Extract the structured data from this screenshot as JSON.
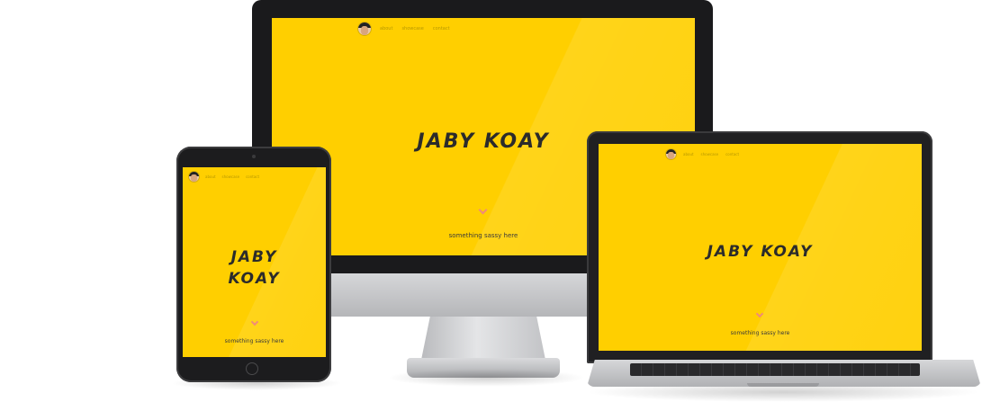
{
  "site": {
    "name": "JABY KOAY",
    "tagline": "something sassy here",
    "nav": [
      "about",
      "showcase",
      "contact"
    ]
  },
  "icons": {
    "avatar": "avatar-photo",
    "scroll": "chevron-down-icon"
  },
  "colors": {
    "screen": "#ffcf00",
    "title": "#2b2b2b",
    "chevron": "#f08a7a",
    "bezel": "#1a1a1c",
    "aluminium": "#c8c9cc"
  }
}
